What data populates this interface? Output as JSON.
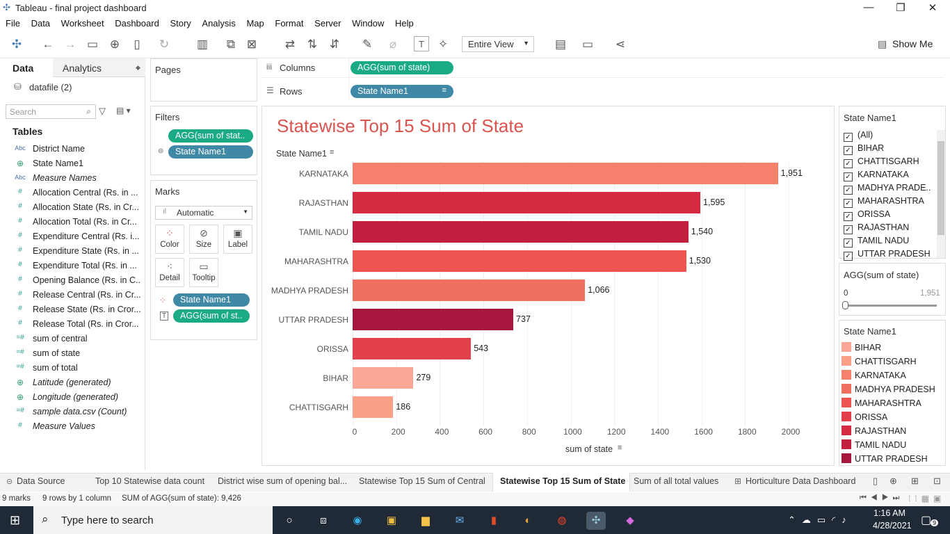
{
  "window": {
    "title": "Tableau - final project dashboard"
  },
  "menu": [
    "File",
    "Data",
    "Worksheet",
    "Dashboard",
    "Story",
    "Analysis",
    "Map",
    "Format",
    "Server",
    "Window",
    "Help"
  ],
  "toolbar": {
    "view_mode": "Entire View",
    "show_me": "Show Me"
  },
  "left": {
    "tabs": [
      "Data",
      "Analytics"
    ],
    "datasource": "datafile (2)",
    "search_placeholder": "Search",
    "tables_label": "Tables",
    "fields": [
      {
        "icon": "Abc",
        "name": "District Name"
      },
      {
        "icon": "globe",
        "name": "State Name1"
      },
      {
        "icon": "Abc",
        "name": "Measure Names"
      },
      {
        "icon": "#",
        "name": "Allocation Central (Rs. in ..."
      },
      {
        "icon": "#",
        "name": "Allocation State (Rs. in Cr..."
      },
      {
        "icon": "#",
        "name": "Allocation Total (Rs. in Cr..."
      },
      {
        "icon": "#",
        "name": "Expenditure Central (Rs. i..."
      },
      {
        "icon": "#",
        "name": "Expenditure State (Rs. in ..."
      },
      {
        "icon": "#",
        "name": "Expenditure Total (Rs. in ..."
      },
      {
        "icon": "#",
        "name": "Opening Balance (Rs. in C..."
      },
      {
        "icon": "#",
        "name": "Release Central (Rs. in Cr..."
      },
      {
        "icon": "#",
        "name": "Release State (Rs. in Cror..."
      },
      {
        "icon": "#",
        "name": "Release Total (Rs. in Cror..."
      },
      {
        "icon": "=#",
        "name": "sum of central"
      },
      {
        "icon": "=#",
        "name": "sum of state"
      },
      {
        "icon": "=#",
        "name": "sum of total"
      },
      {
        "icon": "globe",
        "name": "Latitude (generated)"
      },
      {
        "icon": "globe",
        "name": "Longitude (generated)"
      },
      {
        "icon": "=#",
        "name": "sample data.csv (Count)"
      },
      {
        "icon": "#",
        "name": "Measure Values"
      }
    ]
  },
  "cards": {
    "pages": "Pages",
    "filters": "Filters",
    "filter_pills": [
      "AGG(sum of stat..",
      "State Name1"
    ],
    "marks": "Marks",
    "mark_type": "Automatic",
    "mark_buttons": [
      "Color",
      "Size",
      "Label",
      "Detail",
      "Tooltip"
    ],
    "mark_pills": [
      "State Name1",
      "AGG(sum of st.."
    ]
  },
  "shelves": {
    "columns_label": "Columns",
    "columns_pill": "AGG(sum of state)",
    "rows_label": "Rows",
    "rows_pill": "State Name1"
  },
  "chart_data": {
    "type": "bar",
    "title": "Statewise Top 15  Sum of State",
    "row_header": "State Name1",
    "xlabel": "sum of state",
    "categories": [
      "KARNATAKA",
      "RAJASTHAN",
      "TAMIL NADU",
      "MAHARASHTRA",
      "MADHYA PRADESH",
      "UTTAR PRADESH",
      "ORISSA",
      "BIHAR",
      "CHATTISGARH"
    ],
    "values": [
      1951,
      1595,
      1540,
      1530,
      1066,
      737,
      543,
      279,
      186
    ],
    "value_labels": [
      "1,951",
      "1,595",
      "1,540",
      "1,530",
      "1,066",
      "737",
      "543",
      "279",
      "186"
    ],
    "colors": [
      "#f5806b",
      "#d62a43",
      "#c2203f",
      "#ec5550",
      "#f07060",
      "#a7163d",
      "#e2404a",
      "#fba797",
      "#fb9f89"
    ],
    "xticks": [
      "0",
      "200",
      "400",
      "600",
      "800",
      "1000",
      "1200",
      "1400",
      "1600",
      "1800",
      "2000"
    ],
    "xlim": [
      0,
      2100
    ]
  },
  "right": {
    "filter_title": "State Name1",
    "filter_items": [
      "(All)",
      "BIHAR",
      "CHATTISGARH",
      "KARNATAKA",
      "MADHYA PRADE...",
      "MAHARASHTRA",
      "ORISSA",
      "RAJASTHAN",
      "TAMIL NADU",
      "UTTAR PRADESH"
    ],
    "range_title": "AGG(sum of state)",
    "range_min": "0",
    "range_max": "1,951",
    "legend_title": "State Name1",
    "legend": [
      {
        "name": "BIHAR",
        "color": "#fba797"
      },
      {
        "name": "CHATTISGARH",
        "color": "#fb9f89"
      },
      {
        "name": "KARNATAKA",
        "color": "#f5806b"
      },
      {
        "name": "MADHYA PRADESH",
        "color": "#f07060"
      },
      {
        "name": "MAHARASHTRA",
        "color": "#ec5550"
      },
      {
        "name": "ORISSA",
        "color": "#e2404a"
      },
      {
        "name": "RAJASTHAN",
        "color": "#d62a43"
      },
      {
        "name": "TAMIL NADU",
        "color": "#c2203f"
      },
      {
        "name": "UTTAR PRADESH",
        "color": "#a7163d"
      }
    ]
  },
  "sheets": [
    "Data Source",
    "Top 10 Statewise data count",
    "District wise sum of opening bal...",
    "Statewise Top 15  Sum of Central",
    "Statewise Top 15  Sum of State",
    "Sum of all total values",
    "Horticulture Data Dashboard"
  ],
  "status": {
    "marks": "9 marks",
    "dims": "9 rows by 1 column",
    "sum": "SUM of AGG(sum of state): 9,426"
  },
  "taskbar": {
    "search_placeholder": "Type here to search",
    "time": "1:16 AM",
    "date": "4/28/2021",
    "notifications": "9"
  }
}
